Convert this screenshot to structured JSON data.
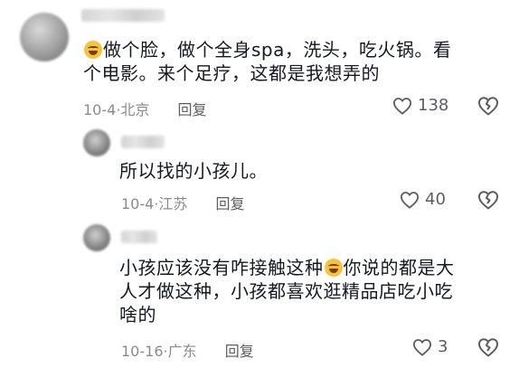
{
  "comments": [
    {
      "text_before": "做个脸，做个全身spa，洗头，吃火锅。看",
      "text_line2": "个电影。来个足疗，这都是我想弄的",
      "date": "10-4",
      "location": "北京",
      "reply_label": "回复",
      "likes": "138"
    },
    {
      "text": "所以找的小孩儿。",
      "date": "10-4",
      "location": "江苏",
      "reply_label": "回复",
      "likes": "40"
    },
    {
      "text_before": "小孩应该没有咋接触这种",
      "text_after": "你说的都是大",
      "text_line2": "人才做这种，小孩都喜欢逛精品店吃小吃",
      "text_line3": "啥的",
      "date": "10-16",
      "location": "广东",
      "reply_label": "回复",
      "likes": "3"
    }
  ],
  "icons": {
    "like": "heart-outline-icon",
    "dislike": "broken-heart-outline-icon",
    "emoji": "laughing-tears-emoji"
  }
}
